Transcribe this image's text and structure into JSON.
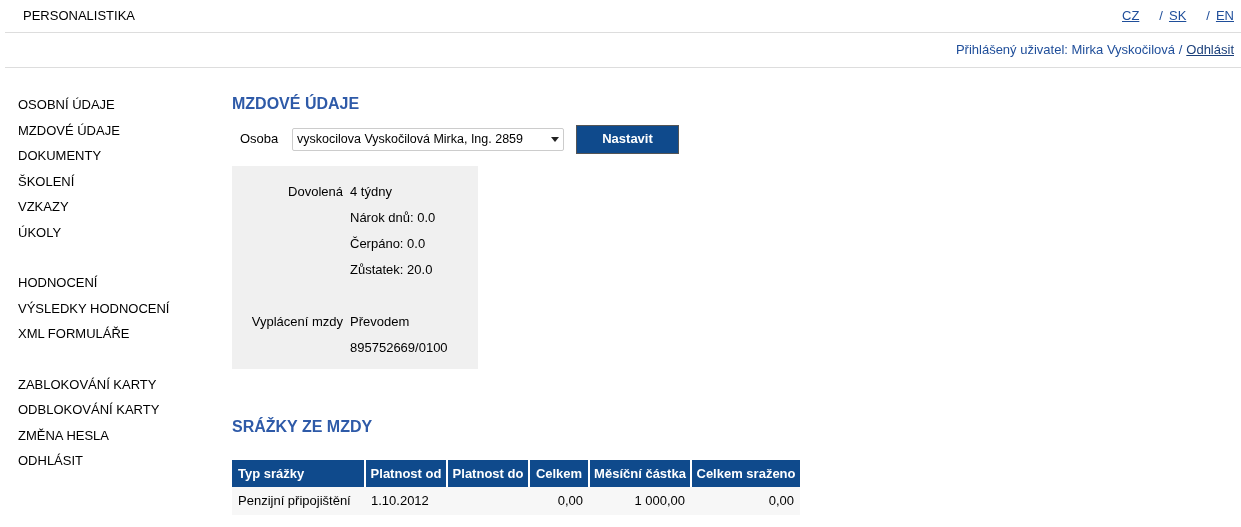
{
  "header": {
    "title": "PERSONALISTIKA",
    "languages": [
      {
        "label": "CZ"
      },
      {
        "separator": "/",
        "label": "SK"
      },
      {
        "separator": "/",
        "label": "EN"
      }
    ]
  },
  "user_bar": {
    "text": "Přihlášený uživatel: Mirka Vyskočilová /",
    "logout": "Odhlásit"
  },
  "sidebar": {
    "groups": [
      {
        "items": [
          "OSOBNÍ ÚDAJE",
          "MZDOVÉ ÚDAJE",
          "DOKUMENTY",
          "ŠKOLENÍ",
          "VZKAZY",
          "ÚKOLY"
        ]
      },
      {
        "items": [
          "HODNOCENÍ",
          "VÝSLEDKY HODNOCENÍ",
          "XML FORMULÁŘE"
        ]
      },
      {
        "items": [
          "ZABLOKOVÁNÍ KARTY",
          "ODBLOKOVÁNÍ KARTY",
          "ZMĚNA HESLA",
          "ODHLÁSIT"
        ]
      }
    ]
  },
  "main": {
    "title": "MZDOVÉ ÚDAJE",
    "person_label": "Osoba",
    "person_value": "vyskocilova Vyskočilová Mirka, Ing. 2859",
    "set_button": "Nastavit",
    "details": [
      {
        "label": "Dovolená",
        "values": [
          "4 týdny",
          "Nárok dnů: 0.0",
          "Čerpáno: 0.0",
          "Zůstatek: 20.0"
        ]
      },
      {
        "label": "Vyplácení mzdy",
        "values": [
          "Převodem",
          "895752669/0100"
        ]
      }
    ]
  },
  "deductions": {
    "title": "SRÁŽKY ZE MZDY",
    "columns": [
      "Typ srážky",
      "Platnost od",
      "Platnost do",
      "Celkem",
      "Měsíční částka",
      "Celkem sraženo"
    ],
    "rows": [
      [
        "Penzijní připojištění",
        "1.10.2012",
        "",
        "0,00",
        "1 000,00",
        "0,00"
      ]
    ]
  }
}
